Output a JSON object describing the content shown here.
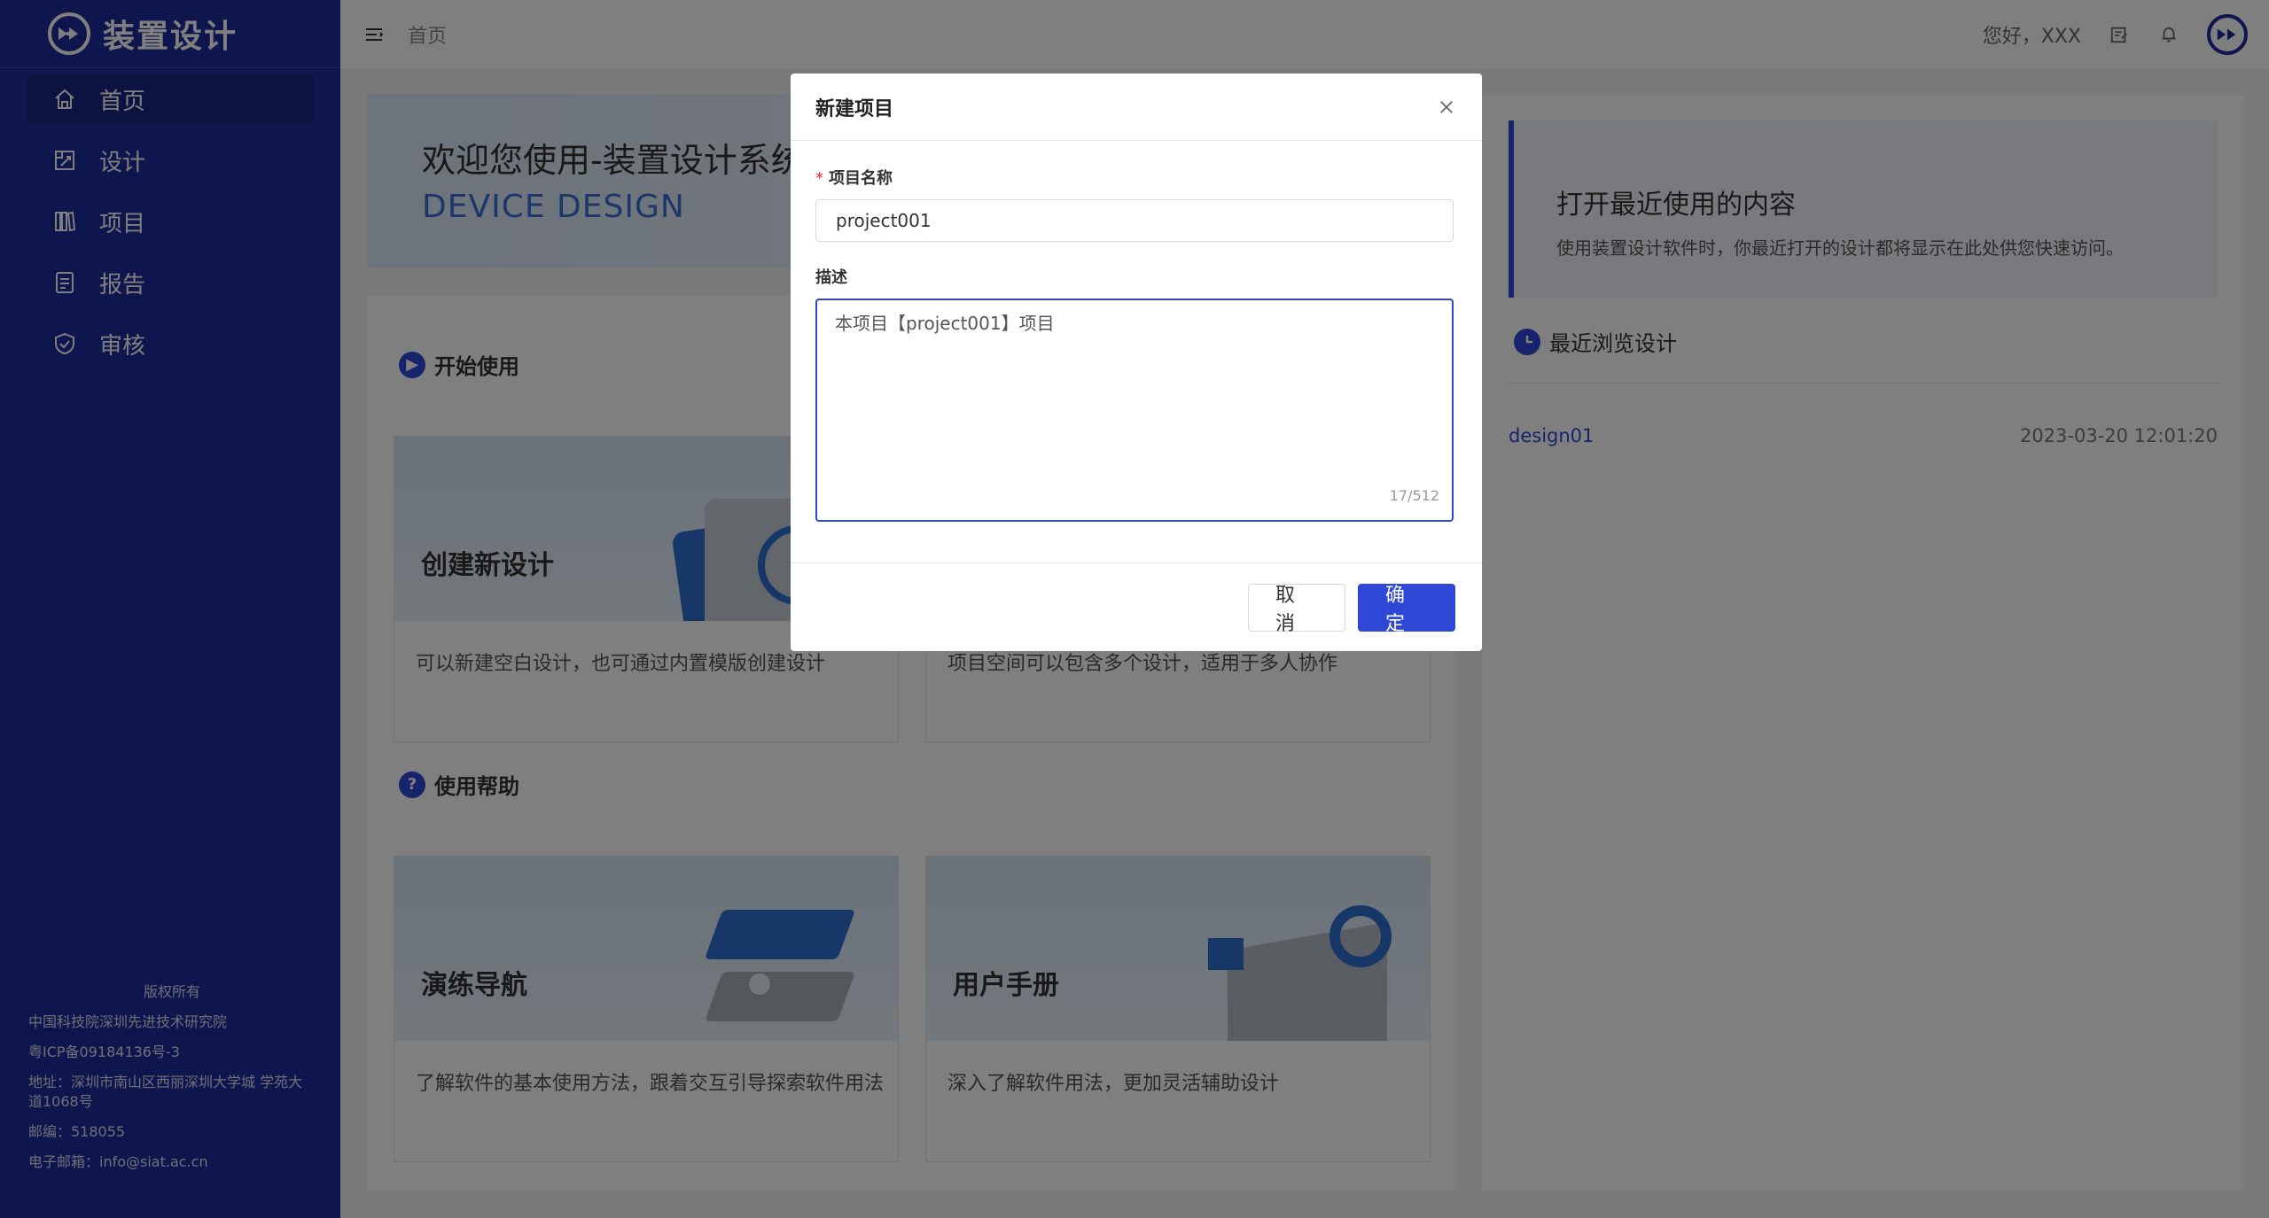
{
  "app": {
    "name": "装置设计"
  },
  "sidebar": {
    "items": [
      {
        "label": "首页",
        "icon": "home-icon"
      },
      {
        "label": "设计",
        "icon": "design-icon"
      },
      {
        "label": "项目",
        "icon": "project-icon"
      },
      {
        "label": "报告",
        "icon": "report-icon"
      },
      {
        "label": "审核",
        "icon": "shield-check-icon"
      }
    ],
    "footer": {
      "copyright": "版权所有",
      "org": "中国科技院深圳先进技术研究院",
      "icp": "粤ICP备09184136号-3",
      "address": "地址：深圳市南山区西丽深圳大学城 学苑大道1068号",
      "postcode": "邮编：518055",
      "email": "电子邮箱：info@siat.ac.cn"
    }
  },
  "header": {
    "breadcrumb": "首页",
    "greeting": "您好，XXX"
  },
  "main": {
    "banner_title": "欢迎您使用-装置设计系统",
    "banner_subtitle": "DEVICE DESIGN",
    "start_section": "开始使用",
    "help_section": "使用帮助",
    "cards": [
      {
        "title": "创建新设计",
        "desc": "可以新建空白设计，也可通过内置模版创建设计"
      },
      {
        "title": "",
        "desc": "项目空间可以包含多个设计，适用于多人协作"
      },
      {
        "title": "演练导航",
        "desc": "了解软件的基本使用方法，跟着交互引导探索软件用法"
      },
      {
        "title": "用户手册",
        "desc": "深入了解软件用法，更加灵活辅助设计"
      }
    ]
  },
  "recent": {
    "box_title": "打开最近使用的内容",
    "box_subtitle": "使用装置设计软件时，你最近打开的设计都将显示在此处供您快速访问。",
    "list_title": "最近浏览设计",
    "items": [
      {
        "name": "design01",
        "time": "2023-03-20 12:01:20"
      }
    ]
  },
  "modal": {
    "title": "新建项目",
    "name_label": "项目名称",
    "name_value": "project001",
    "desc_label": "描述",
    "desc_value": "本项目【project001】项目",
    "desc_count": "17/512",
    "cancel_label": "取 消",
    "ok_label": "确 定"
  },
  "colors": {
    "sidebar": "#1e2c9c",
    "accent": "#2e47d6"
  }
}
